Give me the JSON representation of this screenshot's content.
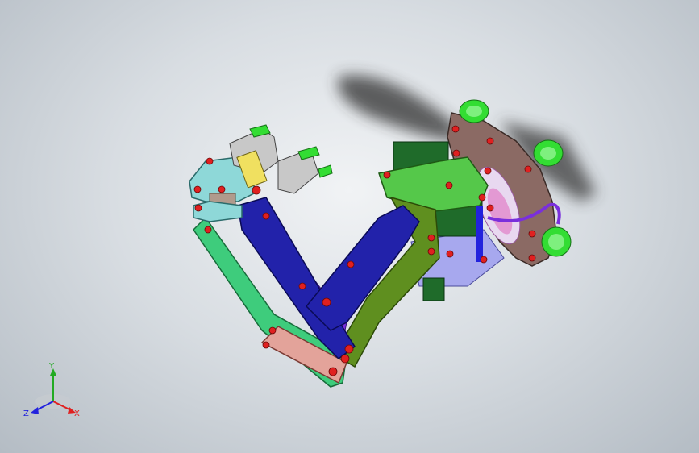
{
  "viewport": {
    "background_center": "#f1f3f5",
    "background_edge": "#b4bcc4"
  },
  "model": {
    "colors": {
      "base_plate": "#8b6a64",
      "suction_cup": "#33dd33",
      "motor_housing": "#1f6b2a",
      "mount_bracket": "#55c84a",
      "inner_arm": "#2222aa",
      "link_violet": "#7a2fdc",
      "olive_arm": "#5f8f1f",
      "lower_link": "#3ecc7c",
      "pink_link": "#e3a39a",
      "wrist_plate": "#8ed8d8",
      "gripper": "#c8c8c8",
      "fastener": "#e02020",
      "shadow": "#333333"
    }
  },
  "triad": {
    "x_label": "X",
    "y_label": "Y",
    "z_label": "Z",
    "x_color": "#e02020",
    "y_color": "#22aa22",
    "z_color": "#2222dd"
  }
}
